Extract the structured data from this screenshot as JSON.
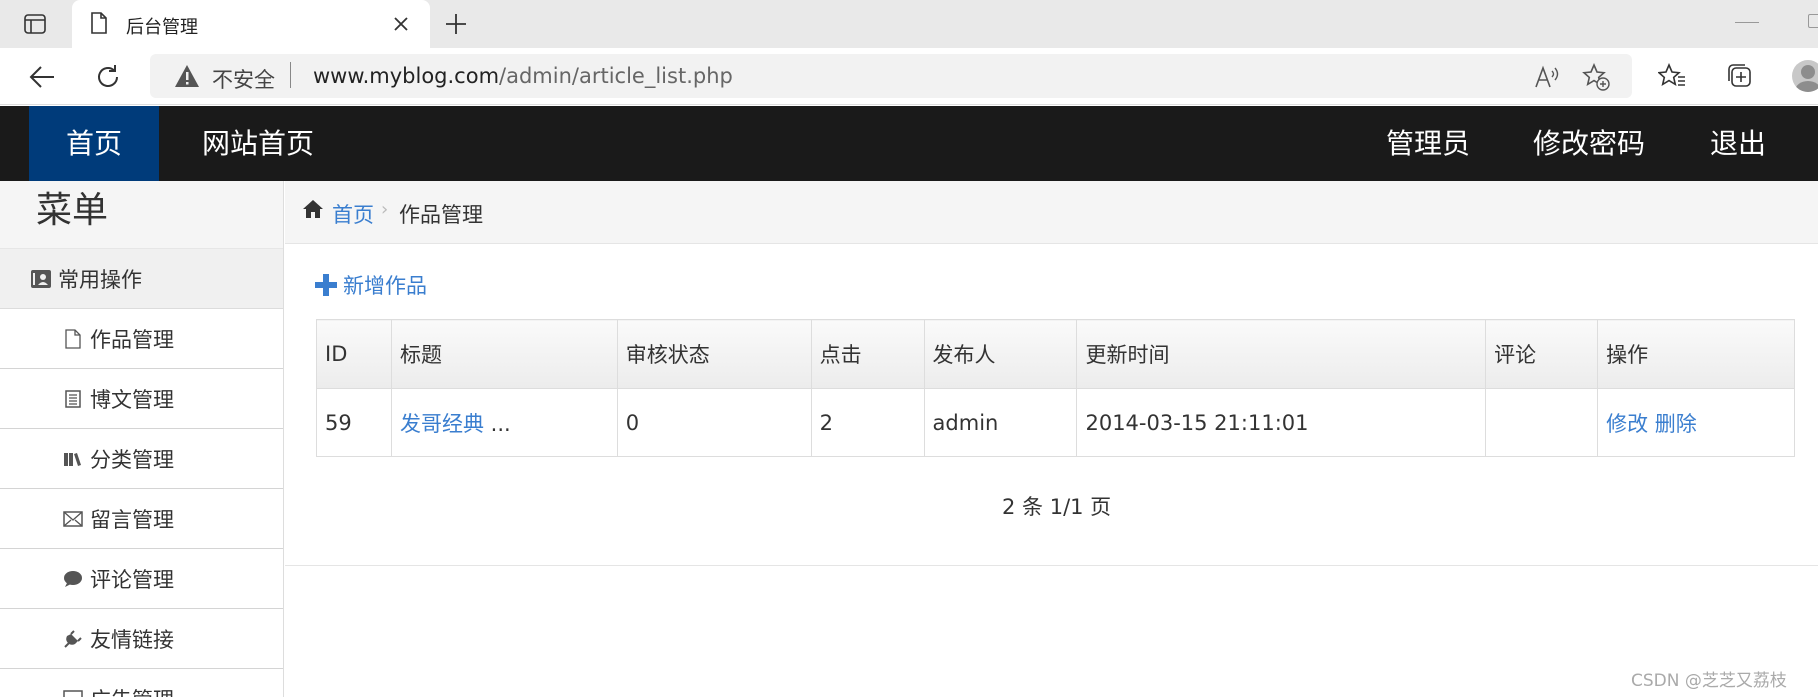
{
  "browser": {
    "tab_title": "后台管理",
    "insecure_label": "不安全",
    "url_host": "www.myblog.com",
    "url_path": "/admin/article_list.php"
  },
  "topnav": {
    "home": "首页",
    "site_home": "网站首页",
    "admin": "管理员",
    "change_password": "修改密码",
    "logout": "退出",
    "active_color": "#003b7a"
  },
  "sidebar": {
    "header": "菜单",
    "group": "常用操作",
    "items": [
      {
        "label": "作品管理",
        "icon": "file-icon"
      },
      {
        "label": "博文管理",
        "icon": "list-icon"
      },
      {
        "label": "分类管理",
        "icon": "books-icon"
      },
      {
        "label": "留言管理",
        "icon": "envelope-icon"
      },
      {
        "label": "评论管理",
        "icon": "comment-icon"
      },
      {
        "label": "友情链接",
        "icon": "plug-icon"
      },
      {
        "label": "广告管理",
        "icon": "image-icon"
      }
    ]
  },
  "breadcrumb": {
    "home": "首页",
    "current": "作品管理"
  },
  "actions": {
    "add": "新增作品"
  },
  "table": {
    "columns": [
      "ID",
      "标题",
      "审核状态",
      "点击",
      "发布人",
      "更新时间",
      "评论",
      "操作"
    ],
    "rows": [
      {
        "id": "59",
        "title": "发哥经典",
        "title_suffix": " ...",
        "status": "0",
        "clicks": "2",
        "author": "admin",
        "updated": "2014-03-15 21:11:01",
        "comments": "",
        "edit": "修改",
        "delete": "删除"
      }
    ]
  },
  "pager": "2 条 1/1 页",
  "watermark": "CSDN @芝芝又荔枝"
}
